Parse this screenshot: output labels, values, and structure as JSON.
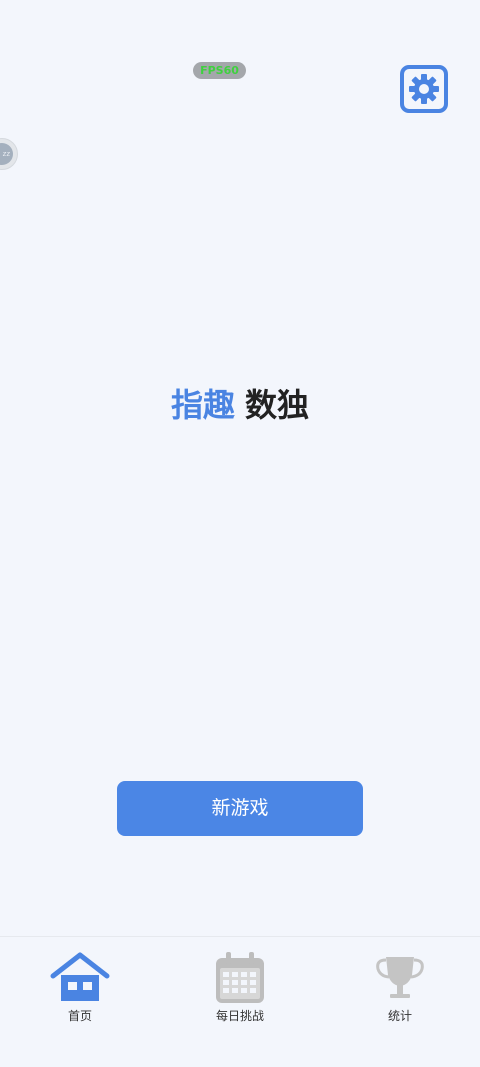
{
  "status": {
    "fps_label": "FPS60"
  },
  "floating_ball": {
    "text": "zz"
  },
  "title": {
    "accent": "指趣",
    "main": "数独",
    "accent_color": "#4a84e2",
    "main_color": "#222222"
  },
  "settings": {
    "icon": "gear-icon",
    "color": "#4a84e2"
  },
  "actions": {
    "new_game_label": "新游戏",
    "button_color": "#4b86e5"
  },
  "nav": {
    "items": [
      {
        "label": "首页",
        "icon": "house-icon",
        "active": true,
        "color": "#4a84e2"
      },
      {
        "label": "每日挑战",
        "icon": "calendar-icon",
        "active": false,
        "color": "#bdbdbd"
      },
      {
        "label": "统计",
        "icon": "trophy-icon",
        "active": false,
        "color": "#bdbdbd"
      }
    ]
  }
}
